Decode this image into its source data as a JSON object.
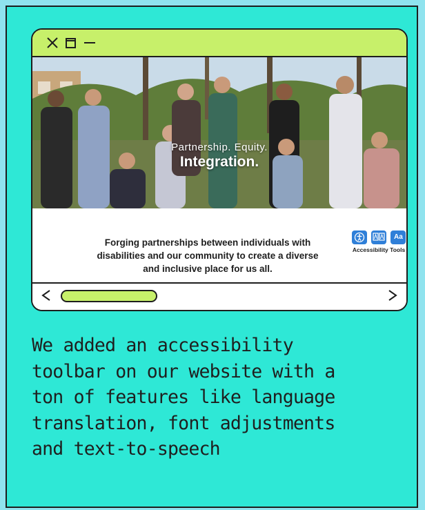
{
  "colors": {
    "page_background": "#8fe3ee",
    "card_background": "#2ee8d6",
    "title_bar": "#c7f06a",
    "scroll_thumb": "#c7f06a",
    "accessibility_button": "#2f7fd8",
    "outline": "#1d1d1d"
  },
  "window": {
    "controls": [
      "close-icon",
      "maximize-icon",
      "minimize-icon"
    ]
  },
  "website": {
    "hero": {
      "tagline": "Partnership. Equity.",
      "headline": "Integration."
    },
    "description_lines": [
      "Forging partnerships between individuals with",
      "disabilities and our community to create a diverse",
      "and inclusive place for us all."
    ],
    "accessibility_tools": {
      "buttons": [
        "accessibility-person-icon",
        "translate-icon",
        "Aa"
      ],
      "label": "Accessibility Tools"
    }
  },
  "scrollbar": {
    "left_arrow": "chevron-left-icon",
    "right_arrow": "chevron-right-icon"
  },
  "caption": {
    "lines": [
      "We added an accessibility",
      "toolbar on our website with a",
      "ton of features like language",
      "translation, font adjustments",
      "and text-to-speech"
    ]
  }
}
